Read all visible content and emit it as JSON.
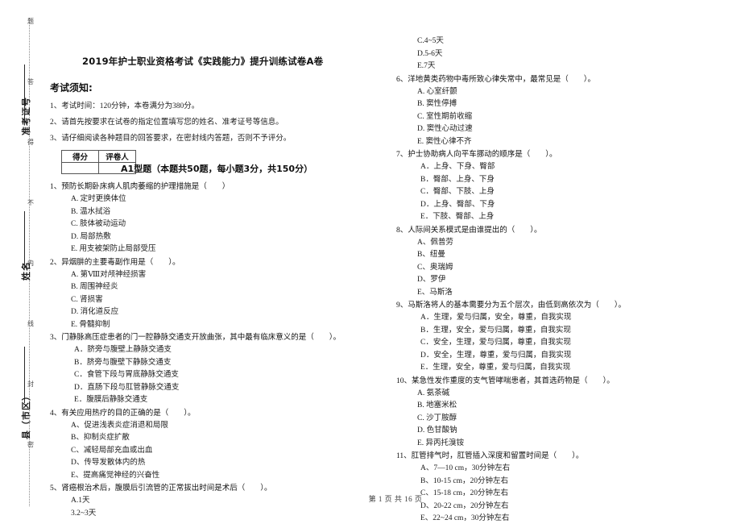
{
  "seal": {
    "chars": [
      "题",
      "答",
      "得",
      "不",
      "内",
      "线",
      "封",
      "密"
    ],
    "labels": [
      {
        "text": "准考证号"
      },
      {
        "text": "姓名"
      },
      {
        "text": "县（市区）"
      }
    ]
  },
  "header": {
    "paper_title": "2019年护士职业资格考试《实践能力》提升训练试卷A卷",
    "notice_title": "考试须知:",
    "notices": [
      "1、考试时间：120分钟，本卷满分为380分。",
      "2、请首先按要求在试卷的指定位置填写您的姓名、准考证号等信息。",
      "3、请仔细阅读各种题目的回答要求，在密封线内答题，否则不予评分。"
    ]
  },
  "scorebox": {
    "score_label": "得分",
    "grader_label": "评卷人",
    "score_value": "",
    "grader_value": ""
  },
  "section": {
    "heading": "A1型题（本题共50题，每小题3分，共150分）"
  },
  "left_column": [
    {
      "stem": "1、预防长期卧床病人肌肉萎缩的护理措施是（　　）",
      "options": [
        "A. 定时更换体位",
        "B. 温水拭浴",
        "C. 肢体被动运动",
        "D. 局部热敷",
        "E. 用支被架防止局部受压"
      ]
    },
    {
      "stem": "2、异烟肼的主要毒副作用是（　　）。",
      "options": [
        "A. 第Ⅷ对颅神经损害",
        "B. 周围神经炎",
        "C. 肾损害",
        "D. 消化道反应",
        "E. 骨髓抑制"
      ]
    },
    {
      "stem": "3、门静脉高压症患者的门一腔静脉交通支开放曲张，其中最有临床意义的是（　　）。",
      "options": [
        "A．脐旁与腹壁上静脉交通支",
        "B．脐旁与腹壁下静脉交通支",
        "C．食管下段与胃底静脉交通支",
        "D．直肠下段与肛管静脉交通支",
        "E．腹膜后静脉交通支"
      ]
    },
    {
      "stem": "4、有关应用热疗的目的正确的是（　　）。",
      "options": [
        "A、促进浅表炎症消退和局限",
        "B、抑制炎症扩散",
        "C、减轻局部充血或出血",
        "D、传导发散体内的热",
        "E、提高痛觉神经的兴奋性"
      ]
    },
    {
      "stem": "5、肾癌根治术后，腹膜后引流管的正常拔出时间是术后（　　）。",
      "options": [
        "A.1天",
        "3.2~3天"
      ]
    }
  ],
  "right_column": [
    {
      "stem": "",
      "options": [
        "C.4~5天",
        "D.5-6天",
        "E.7天"
      ]
    },
    {
      "stem": "6、洋地黄类药物中毒所致心律失常中，最常见是（　　）。",
      "options": [
        "A. 心室纤颤",
        "B. 窦性停搏",
        "C. 室性期前收缩",
        "D. 窦性心动过速",
        "E. 窦性心律不齐"
      ]
    },
    {
      "stem": "7、护士协助病人向平车挪动的顺序是（　　）。",
      "options": [
        "A．上身、下身、臀部",
        "B．臀部、上身、下身",
        "C．臀部、下肢、上身",
        "D．上身、臀部、下身",
        "E．下肢、臀部、上身"
      ]
    },
    {
      "stem": "8、人际间关系模式是由谁提出的（　　）。",
      "options": [
        "A、佩普劳",
        "B、纽曼",
        "C、奥瑞姆",
        "D、罗伊",
        "E、马斯洛"
      ]
    },
    {
      "stem": "9、马斯洛将人的基本需要分为五个层次，由低到高依次为（　　）。",
      "options": [
        "A．生理，爱与归属，安全，尊重，自我实现",
        "B．生理，安全，爱与归属，尊重，自我实现",
        "C．安全，生理，爱与归属，尊重，自我实现",
        "D．安全，生理，尊重，爱与归属，自我实现",
        "E．生理，安全，尊重，爱与归属，自我实现"
      ]
    },
    {
      "stem": "10、某急性发作重度的支气管哮喘患者，其首选药物是（　　）。",
      "options": [
        "A. 氨茶碱",
        "B. 地塞米松",
        "C. 沙丁胺醇",
        "D. 色甘酸钠",
        "E. 异丙托溴铵"
      ]
    },
    {
      "stem": "11、肛管排气时，肛管插入深度和留置时间是（　　）。",
      "options": [
        "A、7—10 cm，30分钟左右",
        "B、10-15 cm，20分钟左右",
        "C、15-18 cm，20分钟左右",
        "D、20-22 cm，20分钟左右",
        "E、22~24 cm，30分钟左右"
      ]
    }
  ],
  "footer": {
    "page_info": "第 1 页 共 16 页"
  }
}
